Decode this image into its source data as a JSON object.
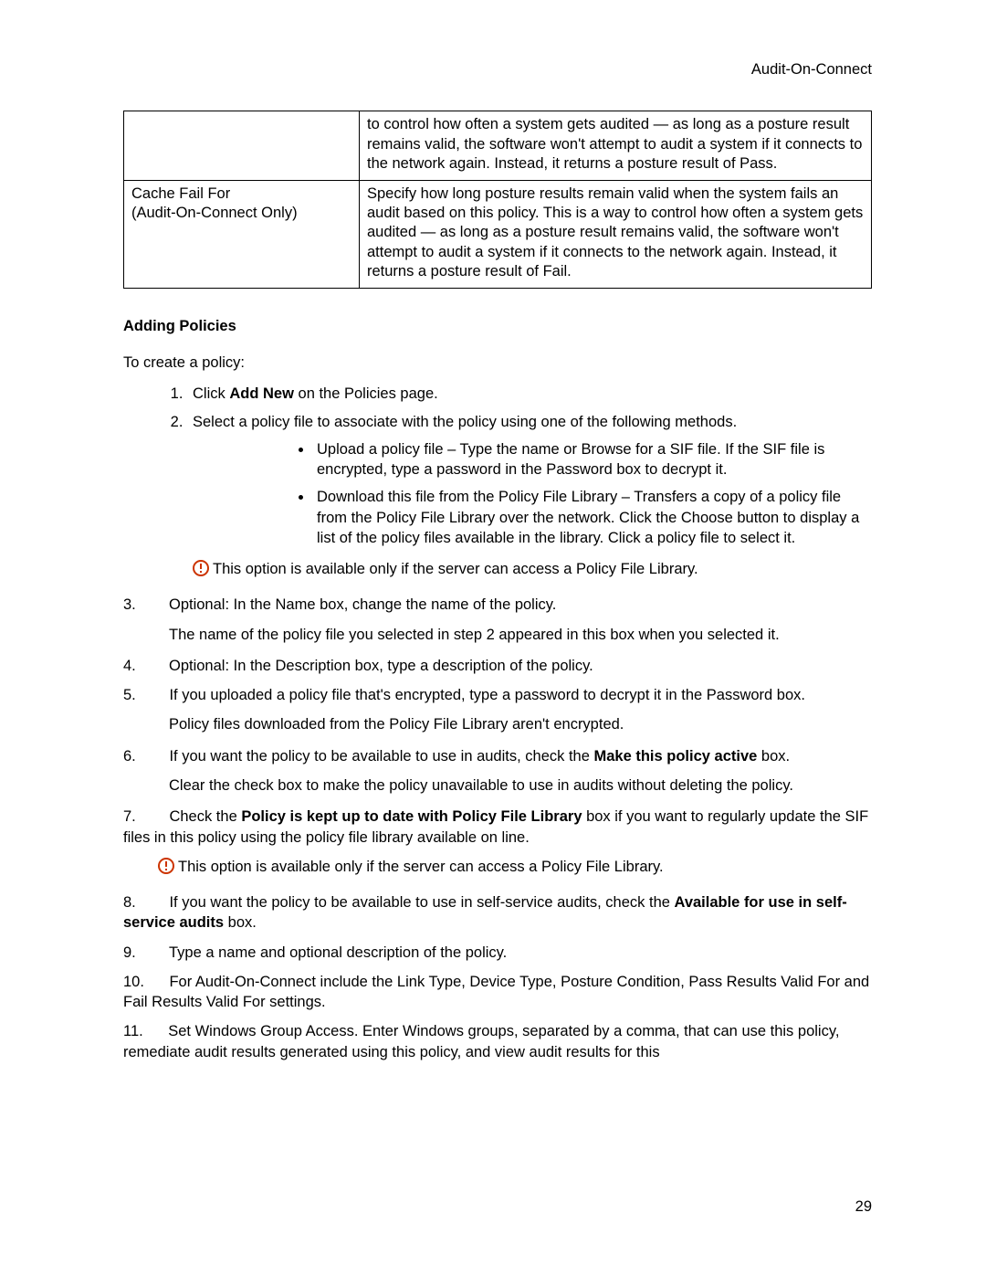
{
  "header": {
    "title": "Audit-On-Connect"
  },
  "table": {
    "row1": {
      "left": "",
      "right": "to control how often a system gets audited — as long as a posture result remains valid, the software won't attempt to audit a system if it connects to the network again. Instead, it returns a posture result of Pass."
    },
    "row2": {
      "left_line1": "Cache Fail For",
      "left_line2": "(Audit-On-Connect Only)",
      "right": "Specify how long posture results remain valid when the system fails an audit based on this policy. This is a way to control how often a system gets audited — as long as a posture result remains valid, the software won't attempt to audit a system if it connects to the network again. Instead, it returns a posture result of Fail."
    }
  },
  "section_heading": "Adding Policies",
  "intro": "To create a policy:",
  "steps": {
    "s1_a": "Click ",
    "s1_b": "Add New",
    "s1_c": " on the Policies page.",
    "s2": "Select a policy file to associate with the policy using one of the following methods.",
    "s2_b1": "Upload a policy file – Type the name or Browse for a SIF file. If the SIF file is encrypted, type a password in the Password box to decrypt it.",
    "s2_b2": "Download this file from the Policy File Library – Transfers a copy of a policy file from the Policy File Library over the network. Click the Choose button to display a list of the policy files available in the library. Click a policy file to select it.",
    "note1": "This option is available only if the server can access a Policy File Library.",
    "s3": "Optional: In the Name box, change the name of the policy.",
    "s3_sub": "The name of the policy file you selected in step 2 appeared in this box when you selected it.",
    "s4": "Optional: In the Description box, type a description of the policy.",
    "s5": "If you uploaded a policy file that's encrypted, type a password to decrypt it in the Password box.",
    "s5_sub": "Policy files downloaded from the Policy File Library aren't encrypted.",
    "s6_a": "If you want the policy to be available to use in audits, check the ",
    "s6_b": "Make this policy active",
    "s6_c": " box.",
    "s6_sub": "Clear the check box to make the policy unavailable to use in audits without deleting the policy.",
    "s7_a": "Check the ",
    "s7_b": "Policy is kept up to date with Policy File Library",
    "s7_c": " box if you want to regularly update the SIF files in this policy using the policy file library available on line.",
    "note2": "This option is available only if the server can access a Policy File Library.",
    "s8_a": "If you want the policy to be available to use in self-service audits, check the ",
    "s8_b": "Available for use in self-service audits",
    "s8_c": " box.",
    "s9": "Type a name and optional description of the policy.",
    "s10": "For Audit-On-Connect include the Link Type, Device Type, Posture Condition, Pass Results Valid For and Fail Results Valid For settings.",
    "s11": "Set Windows Group Access. Enter Windows groups, separated by a comma, that can use this policy, remediate audit results generated using this policy, and view audit results for this"
  },
  "nums": {
    "n3": "3.",
    "n4": "4.",
    "n5": "5.",
    "n6": "6.",
    "n7": "7.",
    "n8": "8.",
    "n9": "9.",
    "n10": "10.",
    "n11": "11."
  },
  "page_number": "29"
}
